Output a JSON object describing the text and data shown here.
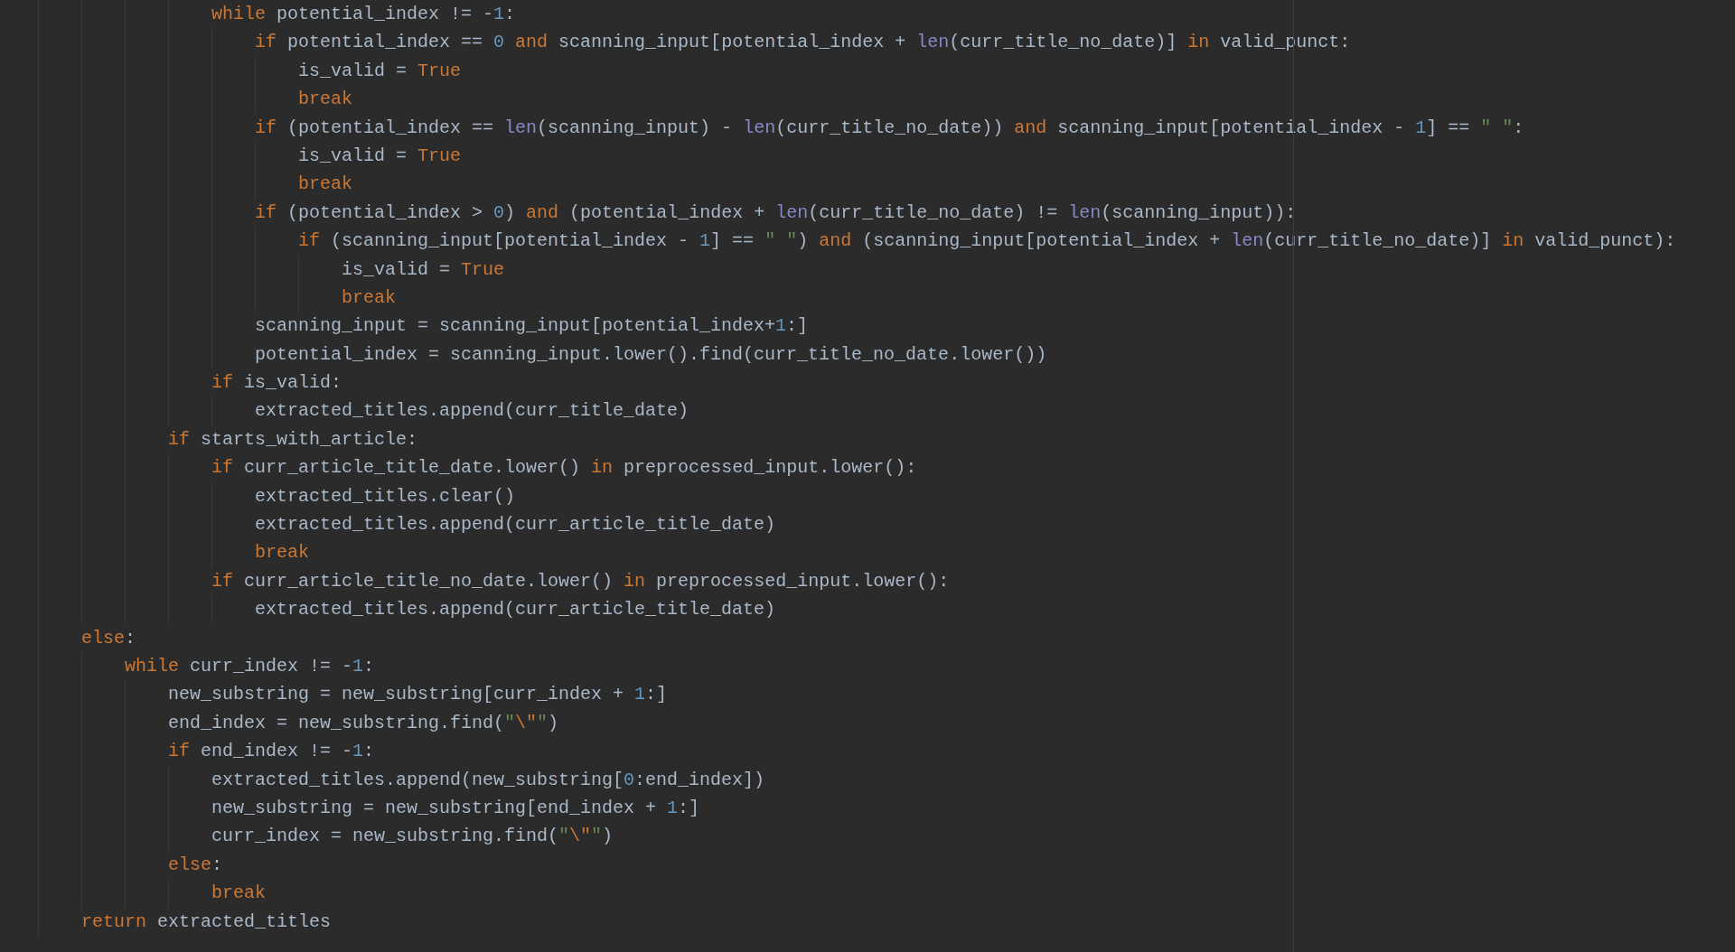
{
  "editor": {
    "lines": [
      {
        "children": [
          {
            "children": [
              {
                "children": [
                  {
                    "children": [
                      {
                        "tokens": [
                          {
                            "kind": "kw",
                            "text": "while"
                          },
                          {
                            "kind": "plain",
                            "text": " potential_index != -"
                          },
                          {
                            "kind": "num",
                            "text": "1"
                          },
                          {
                            "kind": "plain",
                            "text": ":"
                          }
                        ],
                        "children": [
                          {
                            "tokens": [
                              {
                                "kind": "kw",
                                "text": "if"
                              },
                              {
                                "kind": "plain",
                                "text": " potential_index == "
                              },
                              {
                                "kind": "num",
                                "text": "0 "
                              },
                              {
                                "kind": "kw",
                                "text": "and"
                              },
                              {
                                "kind": "plain",
                                "text": " scanning_input[potential_index + "
                              },
                              {
                                "kind": "builtin",
                                "text": "len"
                              },
                              {
                                "kind": "plain",
                                "text": "(curr_title_no_date)] "
                              },
                              {
                                "kind": "kw",
                                "text": "in"
                              },
                              {
                                "kind": "plain",
                                "text": " valid_punct:"
                              }
                            ],
                            "children": [
                              {
                                "tokens": [
                                  {
                                    "kind": "plain",
                                    "text": "is_valid = "
                                  },
                                  {
                                    "kind": "kw",
                                    "text": "True"
                                  }
                                ]
                              },
                              {
                                "tokens": [
                                  {
                                    "kind": "kw",
                                    "text": "break"
                                  }
                                ]
                              }
                            ]
                          },
                          {
                            "tokens": [
                              {
                                "kind": "kw",
                                "text": "if"
                              },
                              {
                                "kind": "plain",
                                "text": " (potential_index == "
                              },
                              {
                                "kind": "builtin",
                                "text": "len"
                              },
                              {
                                "kind": "plain",
                                "text": "(scanning_input) - "
                              },
                              {
                                "kind": "builtin",
                                "text": "len"
                              },
                              {
                                "kind": "plain",
                                "text": "(curr_title_no_date)) "
                              },
                              {
                                "kind": "kw",
                                "text": "and"
                              },
                              {
                                "kind": "plain",
                                "text": " scanning_input[potential_index - "
                              },
                              {
                                "kind": "num",
                                "text": "1"
                              },
                              {
                                "kind": "plain",
                                "text": "] == "
                              },
                              {
                                "kind": "str",
                                "text": "\" \""
                              },
                              {
                                "kind": "plain",
                                "text": ":"
                              }
                            ],
                            "children": [
                              {
                                "tokens": [
                                  {
                                    "kind": "plain",
                                    "text": "is_valid = "
                                  },
                                  {
                                    "kind": "kw",
                                    "text": "True"
                                  }
                                ]
                              },
                              {
                                "tokens": [
                                  {
                                    "kind": "kw",
                                    "text": "break"
                                  }
                                ]
                              }
                            ]
                          },
                          {
                            "tokens": [
                              {
                                "kind": "kw",
                                "text": "if"
                              },
                              {
                                "kind": "plain",
                                "text": " (potential_index > "
                              },
                              {
                                "kind": "num",
                                "text": "0"
                              },
                              {
                                "kind": "plain",
                                "text": ") "
                              },
                              {
                                "kind": "kw",
                                "text": "and"
                              },
                              {
                                "kind": "plain",
                                "text": " (potential_index + "
                              },
                              {
                                "kind": "builtin",
                                "text": "len"
                              },
                              {
                                "kind": "plain",
                                "text": "(curr_title_no_date) != "
                              },
                              {
                                "kind": "builtin",
                                "text": "len"
                              },
                              {
                                "kind": "plain",
                                "text": "(scanning_input)):"
                              }
                            ],
                            "children": [
                              {
                                "tokens": [
                                  {
                                    "kind": "kw",
                                    "text": "if"
                                  },
                                  {
                                    "kind": "plain",
                                    "text": " (scanning_input[potential_index - "
                                  },
                                  {
                                    "kind": "num",
                                    "text": "1"
                                  },
                                  {
                                    "kind": "plain",
                                    "text": "] == "
                                  },
                                  {
                                    "kind": "str",
                                    "text": "\" \""
                                  },
                                  {
                                    "kind": "plain",
                                    "text": ") "
                                  },
                                  {
                                    "kind": "kw",
                                    "text": "and"
                                  },
                                  {
                                    "kind": "plain",
                                    "text": " (scanning_input[potential_index + "
                                  },
                                  {
                                    "kind": "builtin",
                                    "text": "len"
                                  },
                                  {
                                    "kind": "plain",
                                    "text": "(curr_title_no_date)] "
                                  },
                                  {
                                    "kind": "kw",
                                    "text": "in"
                                  },
                                  {
                                    "kind": "plain",
                                    "text": " valid_punct):"
                                  }
                                ],
                                "children": [
                                  {
                                    "tokens": [
                                      {
                                        "kind": "plain",
                                        "text": "is_valid = "
                                      },
                                      {
                                        "kind": "kw",
                                        "text": "True"
                                      }
                                    ]
                                  },
                                  {
                                    "tokens": [
                                      {
                                        "kind": "kw",
                                        "text": "break"
                                      }
                                    ]
                                  }
                                ]
                              }
                            ]
                          },
                          {
                            "tokens": [
                              {
                                "kind": "plain",
                                "text": "scanning_input = scanning_input[potential_index+"
                              },
                              {
                                "kind": "num",
                                "text": "1"
                              },
                              {
                                "kind": "plain",
                                "text": ":]"
                              }
                            ]
                          },
                          {
                            "tokens": [
                              {
                                "kind": "plain",
                                "text": "potential_index = scanning_input.lower().find(curr_title_no_date.lower())"
                              }
                            ]
                          }
                        ]
                      },
                      {
                        "tokens": [
                          {
                            "kind": "kw",
                            "text": "if"
                          },
                          {
                            "kind": "plain",
                            "text": " is_valid:"
                          }
                        ],
                        "children": [
                          {
                            "tokens": [
                              {
                                "kind": "plain",
                                "text": "extracted_titles.append(curr_title_date)"
                              }
                            ]
                          }
                        ]
                      }
                    ]
                  },
                  {
                    "tokens": [
                      {
                        "kind": "kw",
                        "text": "if"
                      },
                      {
                        "kind": "plain",
                        "text": " starts_with_article:"
                      }
                    ],
                    "children": [
                      {
                        "tokens": [
                          {
                            "kind": "kw",
                            "text": "if"
                          },
                          {
                            "kind": "plain",
                            "text": " curr_article_title_date.lower() "
                          },
                          {
                            "kind": "kw",
                            "text": "in"
                          },
                          {
                            "kind": "plain",
                            "text": " preprocessed_input.lower():"
                          }
                        ],
                        "children": [
                          {
                            "tokens": [
                              {
                                "kind": "plain",
                                "text": "extracted_titles.clear()"
                              }
                            ]
                          },
                          {
                            "tokens": [
                              {
                                "kind": "plain",
                                "text": "extracted_titles.append(curr_article_title_date)"
                              }
                            ]
                          },
                          {
                            "tokens": [
                              {
                                "kind": "kw",
                                "text": "break"
                              }
                            ]
                          }
                        ]
                      },
                      {
                        "tokens": [
                          {
                            "kind": "kw",
                            "text": "if"
                          },
                          {
                            "kind": "plain",
                            "text": " curr_article_title_no_date.lower() "
                          },
                          {
                            "kind": "kw",
                            "text": "in"
                          },
                          {
                            "kind": "plain",
                            "text": " preprocessed_input.lower():"
                          }
                        ],
                        "children": [
                          {
                            "tokens": [
                              {
                                "kind": "plain",
                                "text": "extracted_titles.append(curr_article_title_date)"
                              }
                            ]
                          }
                        ]
                      }
                    ]
                  }
                ]
              }
            ]
          },
          {
            "tokens": [
              {
                "kind": "kw",
                "text": "else"
              },
              {
                "kind": "plain",
                "text": ":"
              }
            ],
            "children": [
              {
                "tokens": [
                  {
                    "kind": "kw",
                    "text": "while"
                  },
                  {
                    "kind": "plain",
                    "text": " curr_index != -"
                  },
                  {
                    "kind": "num",
                    "text": "1"
                  },
                  {
                    "kind": "plain",
                    "text": ":"
                  }
                ],
                "children": [
                  {
                    "tokens": [
                      {
                        "kind": "plain",
                        "text": "new_substring = new_substring[curr_index + "
                      },
                      {
                        "kind": "num",
                        "text": "1"
                      },
                      {
                        "kind": "plain",
                        "text": ":]"
                      }
                    ]
                  },
                  {
                    "tokens": [
                      {
                        "kind": "plain",
                        "text": "end_index = new_substring.find("
                      },
                      {
                        "kind": "str",
                        "text": "\""
                      },
                      {
                        "kind": "esc",
                        "text": "\\\""
                      },
                      {
                        "kind": "str",
                        "text": "\""
                      },
                      {
                        "kind": "plain",
                        "text": ")"
                      }
                    ]
                  },
                  {
                    "tokens": [
                      {
                        "kind": "kw",
                        "text": "if"
                      },
                      {
                        "kind": "plain",
                        "text": " end_index != -"
                      },
                      {
                        "kind": "num",
                        "text": "1"
                      },
                      {
                        "kind": "plain",
                        "text": ":"
                      }
                    ],
                    "children": [
                      {
                        "tokens": [
                          {
                            "kind": "plain",
                            "text": "extracted_titles.append(new_substring["
                          },
                          {
                            "kind": "num",
                            "text": "0"
                          },
                          {
                            "kind": "plain",
                            "text": ":end_index])"
                          }
                        ]
                      },
                      {
                        "tokens": [
                          {
                            "kind": "plain",
                            "text": "new_substring = new_substring[end_index + "
                          },
                          {
                            "kind": "num",
                            "text": "1"
                          },
                          {
                            "kind": "plain",
                            "text": ":]"
                          }
                        ]
                      },
                      {
                        "tokens": [
                          {
                            "kind": "plain",
                            "text": "curr_index = new_substring.find("
                          },
                          {
                            "kind": "str",
                            "text": "\""
                          },
                          {
                            "kind": "esc",
                            "text": "\\\""
                          },
                          {
                            "kind": "str",
                            "text": "\""
                          },
                          {
                            "kind": "plain",
                            "text": ")"
                          }
                        ]
                      }
                    ]
                  },
                  {
                    "tokens": [
                      {
                        "kind": "kw",
                        "text": "else"
                      },
                      {
                        "kind": "plain",
                        "text": ":"
                      }
                    ],
                    "children": [
                      {
                        "tokens": [
                          {
                            "kind": "kw",
                            "text": "break"
                          }
                        ]
                      }
                    ]
                  }
                ]
              }
            ]
          },
          {
            "tokens": [
              {
                "kind": "kw",
                "text": "return"
              },
              {
                "kind": "plain",
                "text": " extracted_titles"
              }
            ]
          }
        ]
      }
    ]
  }
}
